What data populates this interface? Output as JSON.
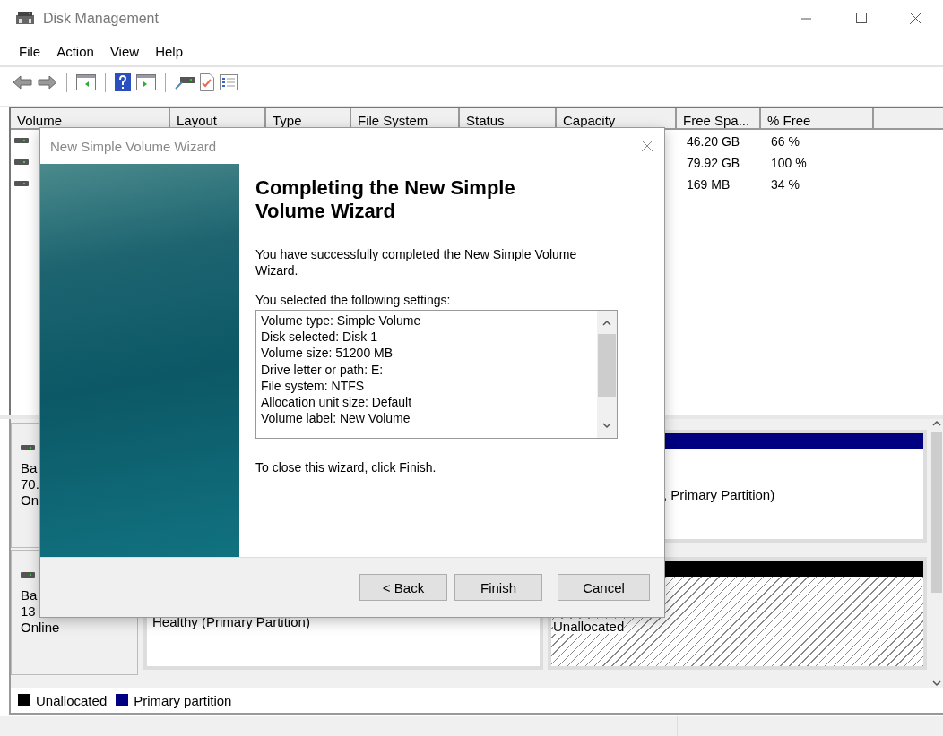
{
  "window": {
    "title": "Disk Management"
  },
  "menu": [
    "File",
    "Action",
    "View",
    "Help"
  ],
  "volume_table": {
    "columns": [
      "Volume",
      "Layout",
      "Type",
      "File System",
      "Status",
      "Capacity",
      "Free Spa...",
      "% Free"
    ],
    "rows": [
      {
        "free_space": "46.20 GB",
        "percent_free": "66 %"
      },
      {
        "free_space": "79.92 GB",
        "percent_free": "100 %"
      },
      {
        "free_space": "169 MB",
        "percent_free": "34 %"
      }
    ]
  },
  "disks": [
    {
      "label_lines": [
        "Ba",
        "70.",
        "On"
      ],
      "partitions": [
        {
          "kind": "primary",
          "text": ", Primary Partition)"
        }
      ]
    },
    {
      "label_lines": [
        "Ba",
        "13",
        "Online"
      ],
      "partitions": [
        {
          "kind": "primary",
          "text": "Healthy (Primary Partition)"
        },
        {
          "kind": "unallocated",
          "text": "Unallocated"
        }
      ]
    }
  ],
  "legend": [
    {
      "label": "Unallocated",
      "color": "#000000"
    },
    {
      "label": "Primary partition",
      "color": "#000080"
    }
  ],
  "dialog": {
    "title": "New Simple Volume Wizard",
    "heading": "Completing the New Simple Volume Wizard",
    "message": "You have successfully completed the New Simple Volume Wizard.",
    "settings_label": "You selected the following settings:",
    "settings": [
      "Volume type: Simple Volume",
      "Disk selected: Disk 1",
      "Volume size: 51200 MB",
      "Drive letter or path: E:",
      "File system: NTFS",
      "Allocation unit size: Default",
      "Volume label: New Volume"
    ],
    "closing": "To close this wizard, click Finish.",
    "buttons": [
      "< Back",
      "Finish",
      "Cancel"
    ]
  }
}
